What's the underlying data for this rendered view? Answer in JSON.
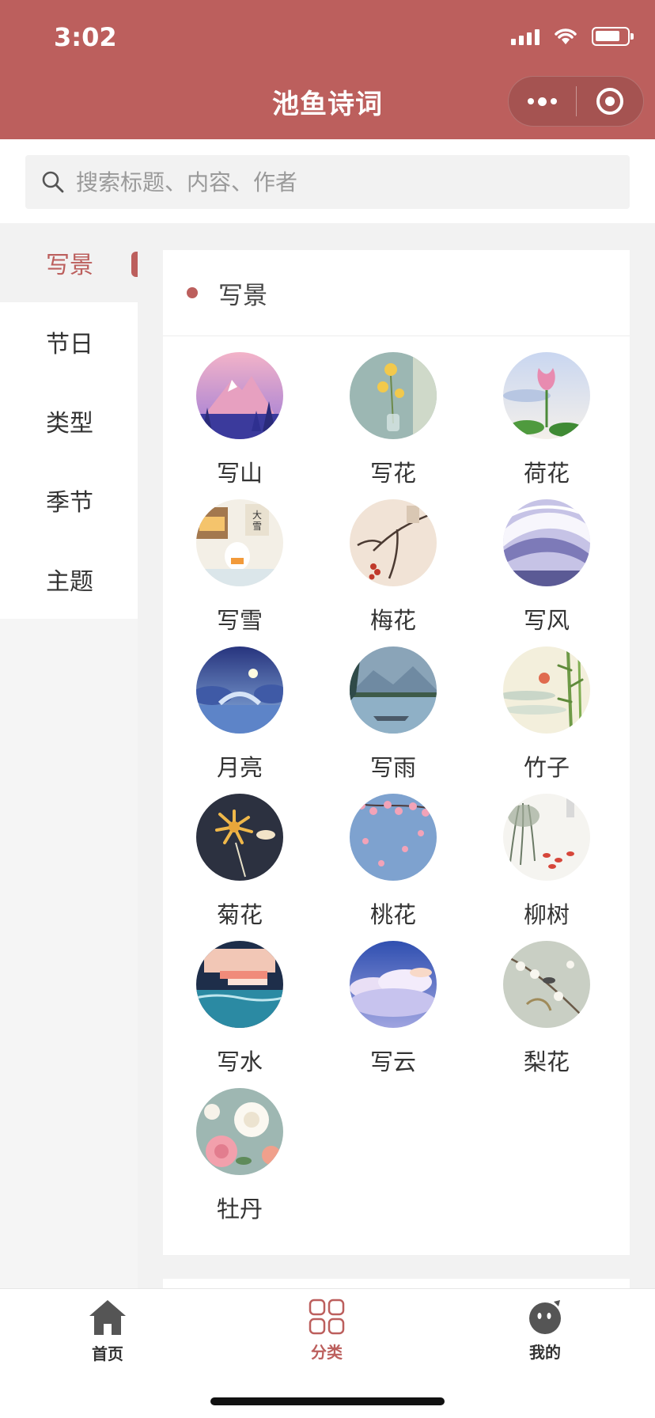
{
  "status_bar": {
    "time": "3:02"
  },
  "nav": {
    "title": "池鱼诗词"
  },
  "search": {
    "placeholder": "搜索标题、内容、作者"
  },
  "sidebar": {
    "items": [
      {
        "label": "写景",
        "active": true
      },
      {
        "label": "节日",
        "active": false
      },
      {
        "label": "类型",
        "active": false
      },
      {
        "label": "季节",
        "active": false
      },
      {
        "label": "主题",
        "active": false
      }
    ]
  },
  "section": {
    "title": "写景",
    "items": [
      {
        "label": "写山",
        "icon": "mountain-image"
      },
      {
        "label": "写花",
        "icon": "flower-vase-image"
      },
      {
        "label": "荷花",
        "icon": "lotus-image"
      },
      {
        "label": "写雪",
        "icon": "snow-image"
      },
      {
        "label": "梅花",
        "icon": "plum-blossom-image"
      },
      {
        "label": "写风",
        "icon": "wind-image"
      },
      {
        "label": "月亮",
        "icon": "moon-image"
      },
      {
        "label": "写雨",
        "icon": "rain-image"
      },
      {
        "label": "竹子",
        "icon": "bamboo-image"
      },
      {
        "label": "菊花",
        "icon": "chrysanthemum-image"
      },
      {
        "label": "桃花",
        "icon": "peach-blossom-image"
      },
      {
        "label": "柳树",
        "icon": "willow-image"
      },
      {
        "label": "写水",
        "icon": "water-image"
      },
      {
        "label": "写云",
        "icon": "cloud-image"
      },
      {
        "label": "梨花",
        "icon": "pear-blossom-image"
      },
      {
        "label": "牡丹",
        "icon": "peony-image"
      }
    ]
  },
  "tabbar": {
    "items": [
      {
        "label": "首页",
        "icon": "home-icon",
        "active": false
      },
      {
        "label": "分类",
        "icon": "category-grid-icon",
        "active": true
      },
      {
        "label": "我的",
        "icon": "profile-face-icon",
        "active": false
      }
    ]
  },
  "colors": {
    "accent": "#bc5f5d",
    "background": "#f2f2f2"
  }
}
